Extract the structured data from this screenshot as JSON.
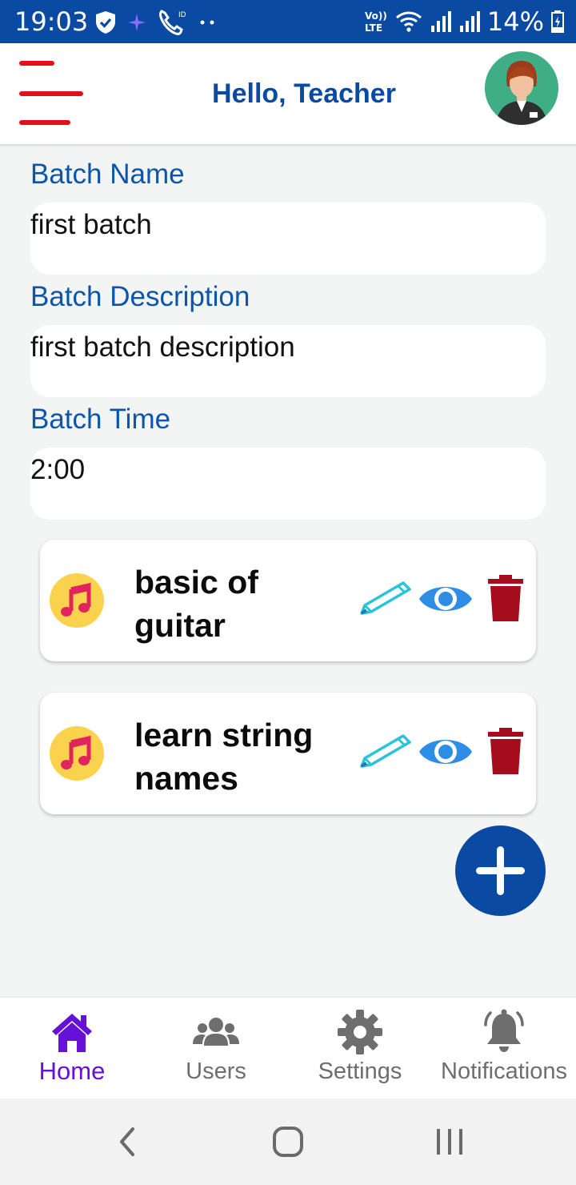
{
  "status_bar": {
    "time": "19:03",
    "battery": "14%",
    "network_label": "Vo)) LTE"
  },
  "app_bar": {
    "title": "Hello, Teacher",
    "menu_icon": "hamburger-icon",
    "avatar_icon": "teacher-avatar"
  },
  "form": {
    "batch_name_label": "Batch Name",
    "batch_name_value": "first batch",
    "batch_description_label": "Batch Description",
    "batch_description_value": "first batch description",
    "batch_time_label": "Batch Time",
    "batch_time_value": "2:00"
  },
  "lessons": [
    {
      "title": "basic of guitar"
    },
    {
      "title": "learn string names"
    }
  ],
  "bottom_nav": {
    "items": [
      {
        "label": "Home",
        "icon": "home-icon",
        "active": true
      },
      {
        "label": "Users",
        "icon": "users-icon",
        "active": false
      },
      {
        "label": "Settings",
        "icon": "gear-icon",
        "active": false
      },
      {
        "label": "Notifications",
        "icon": "bell-icon",
        "active": false
      }
    ]
  },
  "colors": {
    "primary": "#0b4aa2",
    "label_blue": "#0b56a8",
    "menu_red": "#e3101a",
    "active_nav": "#6611d8",
    "delete_red": "#a50d1c",
    "eye_blue": "#2e8ee6",
    "pencil_teal": "#2bc3d8"
  }
}
